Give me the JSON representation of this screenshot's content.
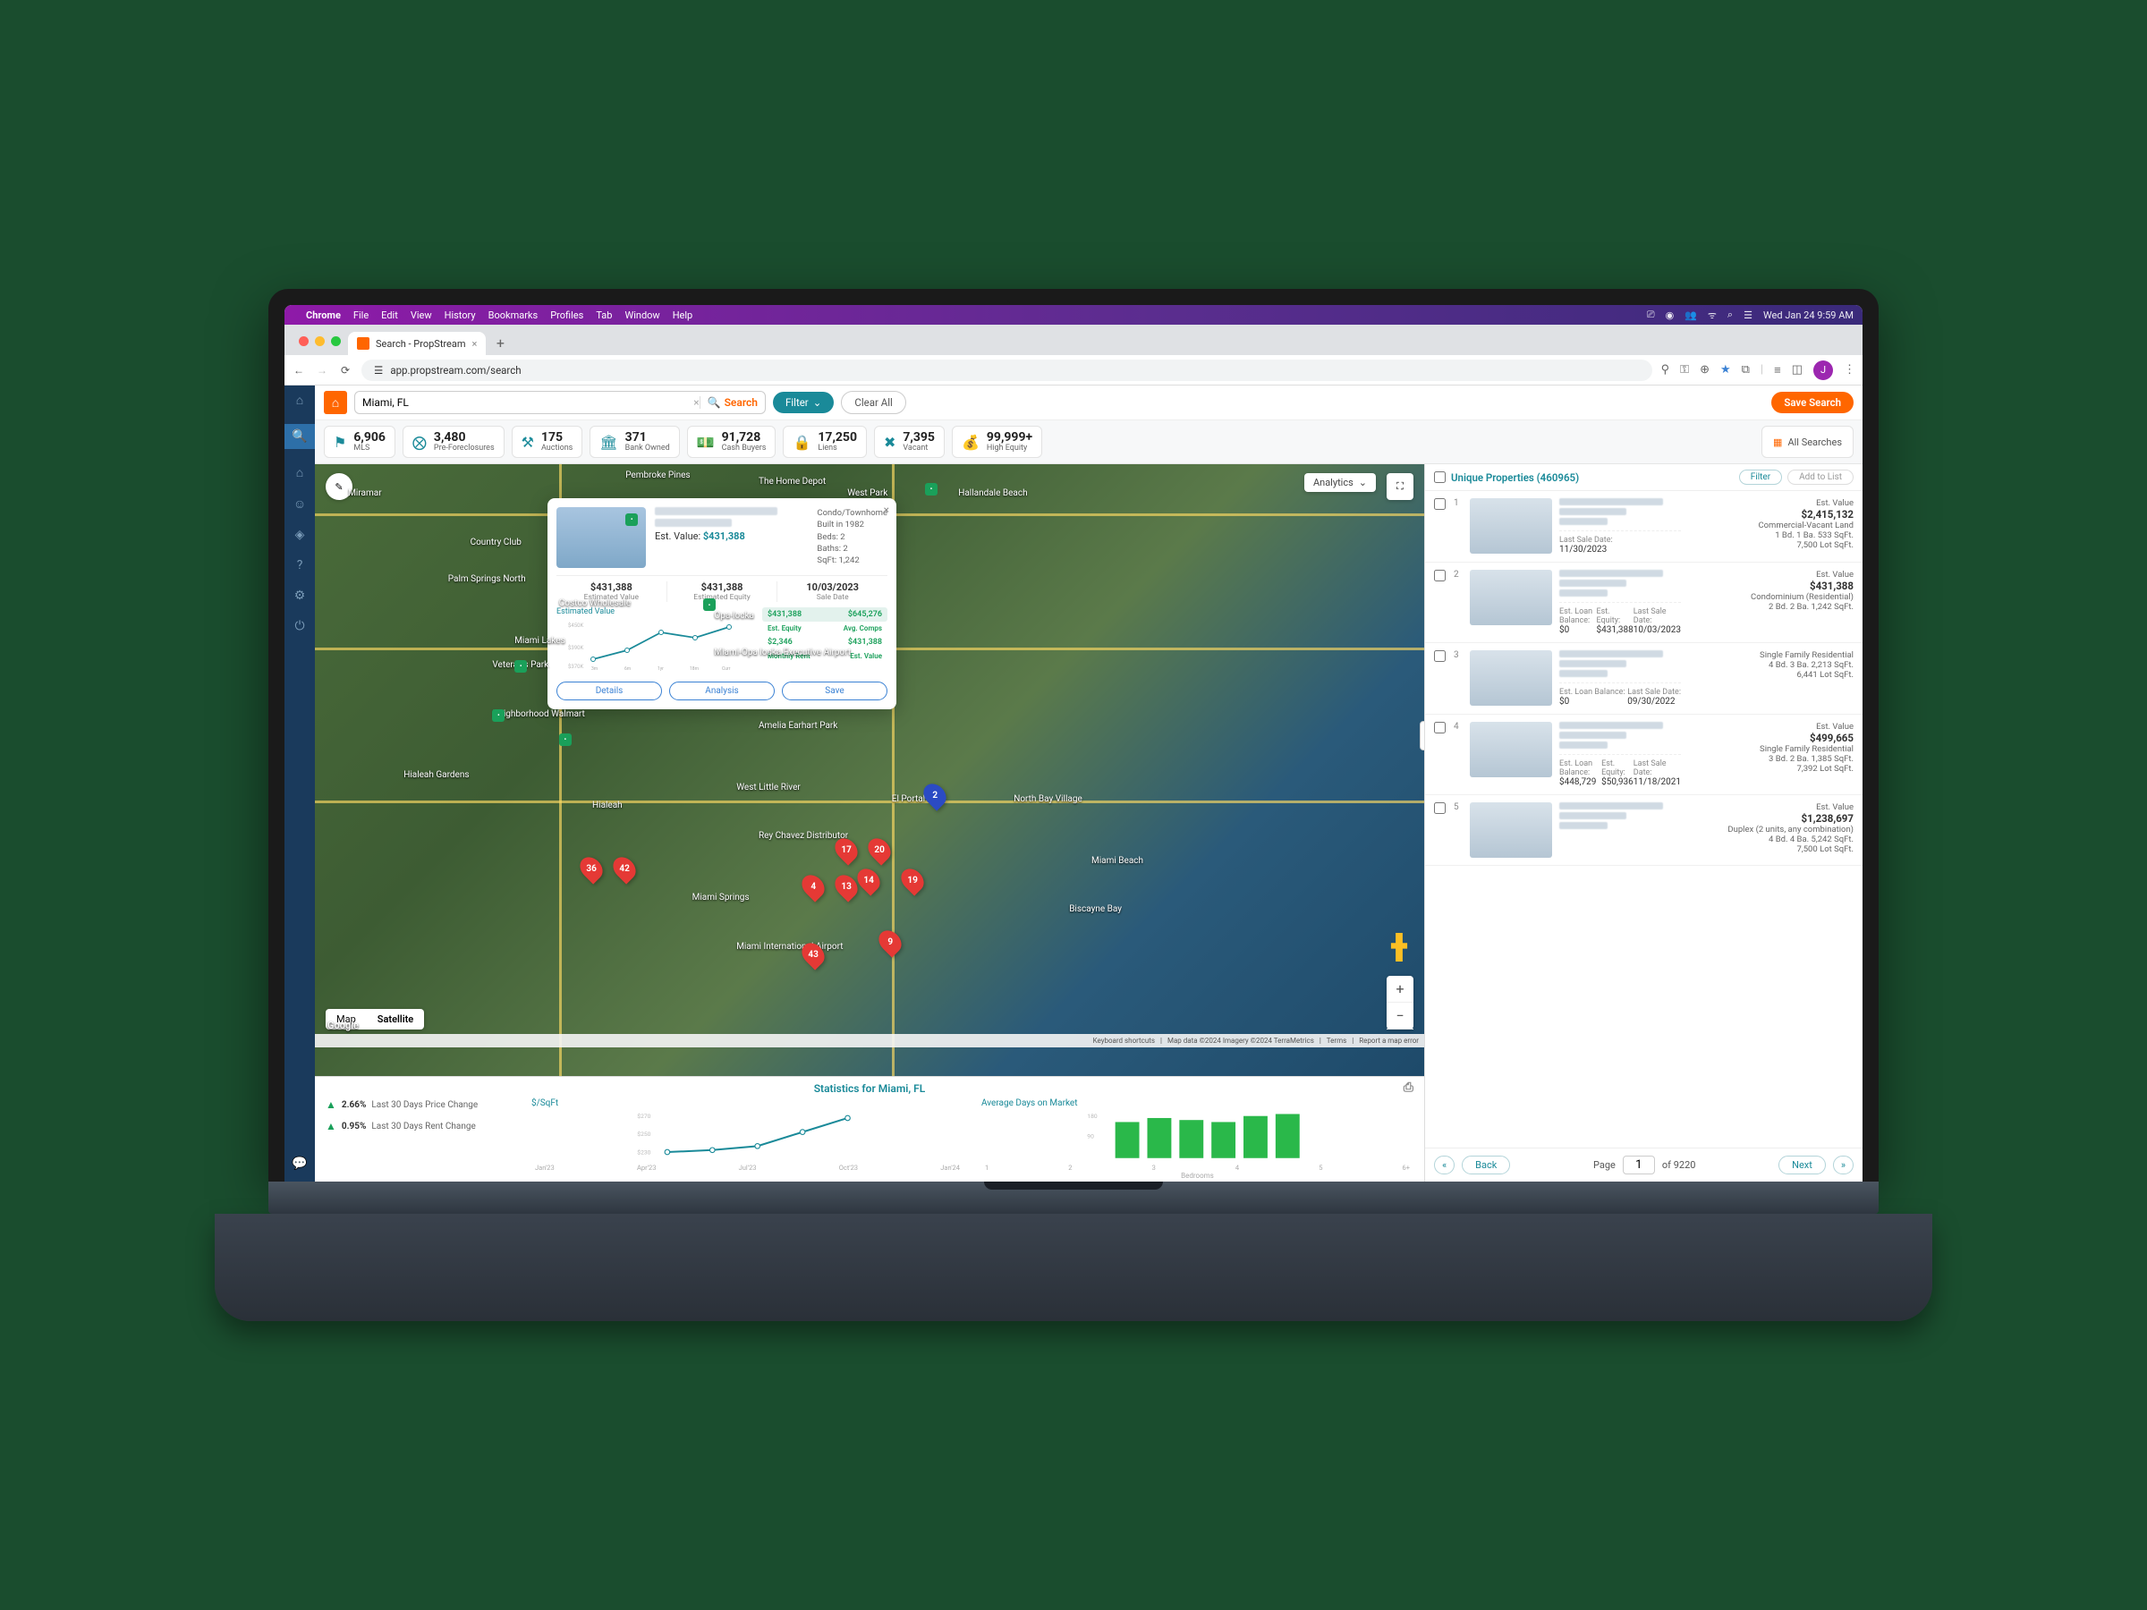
{
  "menubar": {
    "browser": "Chrome",
    "items": [
      "File",
      "Edit",
      "View",
      "History",
      "Bookmarks",
      "Profiles",
      "Tab",
      "Window",
      "Help"
    ],
    "datetime": "Wed Jan 24  9:59 AM"
  },
  "tab": {
    "title": "Search - PropStream"
  },
  "url": "app.propstream.com/search",
  "search": {
    "value": "Miami, FL",
    "button": "Search",
    "filter": "Filter",
    "clear": "Clear All",
    "save": "Save Search"
  },
  "stats": [
    {
      "num": "6,906",
      "label": "MLS",
      "icon": "⚑"
    },
    {
      "num": "3,480",
      "label": "Pre-Foreclosures",
      "icon": "⨂"
    },
    {
      "num": "175",
      "label": "Auctions",
      "icon": "⚒"
    },
    {
      "num": "371",
      "label": "Bank Owned",
      "icon": "🏛"
    },
    {
      "num": "91,728",
      "label": "Cash Buyers",
      "icon": "💵"
    },
    {
      "num": "17,250",
      "label": "Liens",
      "icon": "🔒"
    },
    {
      "num": "7,395",
      "label": "Vacant",
      "icon": "✖"
    },
    {
      "num": "99,999+",
      "label": "High Equity",
      "icon": "💰"
    }
  ],
  "all_searches": "All Searches",
  "map": {
    "analytics": "Analytics",
    "types": {
      "map": "Map",
      "sat": "Satellite"
    },
    "labels": [
      "Miramar",
      "Pembroke Pines",
      "Hallandale Beach",
      "The Home Depot",
      "West Park",
      "Miami Lakes",
      "Country Club",
      "Palm Springs North",
      "Hialeah",
      "Hialeah Gardens",
      "Opa-locka",
      "Neighborhood Walmart",
      "West Little River",
      "El Portal",
      "North Bay Village",
      "Miami Beach",
      "Miami Springs",
      "Costco Wholesale",
      "Miami-Opa locka Executive Airport",
      "Amelia Earhart Park",
      "Biscayne Bay",
      "Veteran's Park",
      "Miami International Airport",
      "Rey Chavez Distributor"
    ],
    "pins": [
      "2",
      "17",
      "20",
      "4",
      "13",
      "14",
      "19",
      "36",
      "42",
      "43",
      "9"
    ],
    "footer": {
      "kb": "Keyboard shortcuts",
      "imagery": "Map data ©2024 Imagery ©2024 TerraMetrics",
      "terms": "Terms",
      "report": "Report a map error"
    },
    "google": "Google"
  },
  "popup": {
    "est_label": "Est. Value:",
    "est_value": "$431,388",
    "facts": {
      "type": "Condo/Townhome",
      "built": "Built in 1982",
      "beds": "Beds: 2",
      "baths": "Baths: 2",
      "sqft": "SqFt: 1,242"
    },
    "cols": [
      {
        "v": "$431,388",
        "l": "Estimated Value"
      },
      {
        "v": "$431,388",
        "l": "Estimated Equity"
      },
      {
        "v": "10/03/2023",
        "l": "Sale Date"
      }
    ],
    "chart_title": "Estimated Value",
    "comps": [
      {
        "a": "$431,388",
        "b": "$645,276",
        "la": "Est. Equity",
        "lb": "Avg. Comps",
        "hl": true
      },
      {
        "a": "$2,346",
        "b": "$431,388",
        "la": "Monthly Rent",
        "lb": "Est. Value"
      }
    ],
    "buttons": {
      "details": "Details",
      "analysis": "Analysis",
      "save": "Save"
    }
  },
  "btm": {
    "title": "Statistics for Miami, FL",
    "changes": [
      {
        "pct": "2.66%",
        "label": "Last 30 Days Price Change"
      },
      {
        "pct": "0.95%",
        "label": "Last 30 Days Rent Change"
      }
    ],
    "sqft": {
      "title": "$/SqFt",
      "ticks": [
        "$270",
        "$250",
        "$230"
      ],
      "x": [
        "Jan'23",
        "Apr'23",
        "Jul'23",
        "Oct'23",
        "Jan'24"
      ]
    },
    "dom": {
      "title": "Average Days on Market",
      "ticks": [
        "180",
        "90"
      ],
      "x": [
        "1",
        "2",
        "3",
        "4",
        "5",
        "6+"
      ],
      "sub": "Bedrooms"
    }
  },
  "list": {
    "header": "Unique Properties (460965)",
    "filter": "Filter",
    "add": "Add to List",
    "items": [
      {
        "idx": "1",
        "ev_label": "Est. Value",
        "ev": "$2,415,132",
        "type": "Commercial-Vacant Land",
        "meta": "1 Bd.  1 Ba.  533 SqFt.",
        "lot": "7,500 Lot SqFt.",
        "sub": [
          {
            "l": "Last Sale Date:",
            "v": "11/30/2023"
          }
        ]
      },
      {
        "idx": "2",
        "ev_label": "Est. Value",
        "ev": "$431,388",
        "type": "Condominium (Residential)",
        "meta": "2 Bd.  2 Ba.  1,242 SqFt.",
        "sub": [
          {
            "l": "Est. Loan Balance:",
            "v": "$0"
          },
          {
            "l": "Est. Equity:",
            "v": "$431,388"
          },
          {
            "l": "Last Sale Date:",
            "v": "10/03/2023"
          }
        ]
      },
      {
        "idx": "3",
        "ev_label": "",
        "ev": "",
        "type": "Single Family Residential",
        "meta": "4 Bd.  3 Ba.  2,213 SqFt.",
        "lot": "6,441 Lot SqFt.",
        "sub": [
          {
            "l": "Est. Loan Balance:",
            "v": "$0"
          },
          {
            "l": "Last Sale Date:",
            "v": "09/30/2022"
          }
        ]
      },
      {
        "idx": "4",
        "ev_label": "Est. Value",
        "ev": "$499,665",
        "type": "Single Family Residential",
        "meta": "3 Bd.  2 Ba.  1,385 SqFt.",
        "lot": "7,392 Lot SqFt.",
        "sub": [
          {
            "l": "Est. Loan Balance:",
            "v": "$448,729"
          },
          {
            "l": "Est. Equity:",
            "v": "$50,936"
          },
          {
            "l": "Last Sale Date:",
            "v": "11/18/2021"
          }
        ]
      },
      {
        "idx": "5",
        "ev_label": "Est. Value",
        "ev": "$1,238,697",
        "type": "Duplex (2 units, any combination)",
        "meta": "4 Bd.  4 Ba.  5,242 SqFt.",
        "lot": "7,500 Lot SqFt.",
        "sub": []
      }
    ],
    "pager": {
      "back": "Back",
      "page": "Page",
      "cur": "1",
      "of": "of 9220",
      "next": "Next"
    }
  },
  "chart_data": [
    {
      "type": "line",
      "title": "Estimated Value",
      "x": [
        "3m",
        "6m",
        "1yr",
        "18m",
        "Curr"
      ],
      "values": [
        380000,
        397000,
        430000,
        424000,
        440000
      ],
      "ylim": [
        370000,
        450000
      ],
      "y_ticks": [
        "$450K",
        "$390K",
        "$370K"
      ]
    },
    {
      "type": "line",
      "title": "$/SqFt",
      "x": [
        "Jan'23",
        "Apr'23",
        "Jul'23",
        "Oct'23",
        "Jan'24"
      ],
      "values": [
        234,
        236,
        240,
        255,
        268
      ],
      "ylim": [
        230,
        270
      ]
    },
    {
      "type": "bar",
      "title": "Average Days on Market",
      "categories": [
        "1",
        "2",
        "3",
        "4",
        "5",
        "6+"
      ],
      "values": [
        140,
        155,
        150,
        145,
        160,
        165
      ],
      "ylim": [
        0,
        180
      ],
      "xlabel": "Bedrooms"
    }
  ]
}
